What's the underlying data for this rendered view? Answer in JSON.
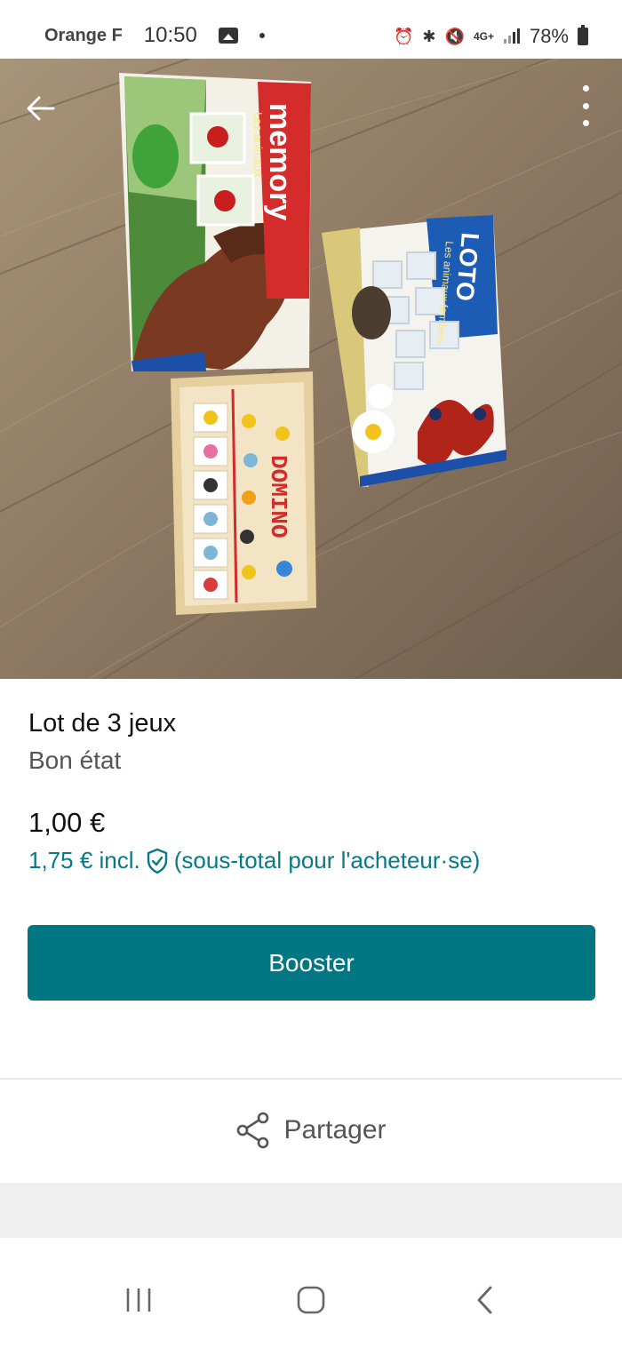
{
  "status_bar": {
    "carrier": "Orange F",
    "time": "10:50",
    "network": "4G+",
    "battery": "78%"
  },
  "photo": {
    "games": [
      "memory",
      "LOTO",
      "DOMINO"
    ],
    "memory_sub": "Les animaux",
    "loto_sub": "Les animaux familiers"
  },
  "item": {
    "title": "Lot de 3 jeux",
    "condition": "Bon état",
    "price": "1,00 €",
    "buyer_total": "1,75 € incl.",
    "buyer_note": "(sous-total pour l'acheteur·se)"
  },
  "actions": {
    "boost_label": "Booster",
    "share_label": "Partager"
  },
  "colors": {
    "accent": "#017783",
    "link": "#097987"
  },
  "icons": {
    "back": "arrow-left-icon",
    "more": "more-vertical-icon",
    "shield": "shield-check-icon",
    "share": "share-icon"
  }
}
